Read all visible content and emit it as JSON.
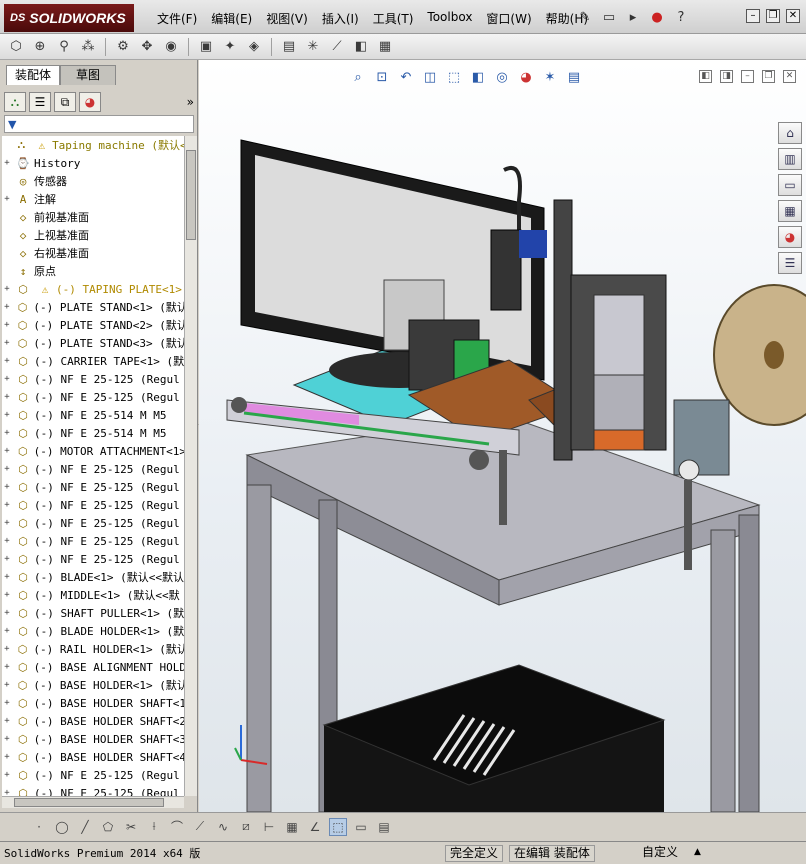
{
  "app": {
    "logo_brand": "DS",
    "logo_text": "SOLIDWORKS"
  },
  "menu": [
    "文件(F)",
    "编辑(E)",
    "视图(V)",
    "插入(I)",
    "工具(T)",
    "Toolbox",
    "窗口(W)",
    "帮助(H)"
  ],
  "title_tools": [
    "pin-icon",
    "new-doc-icon",
    "open-icon",
    "rebuild-traffic-icon",
    "help-icon"
  ],
  "window_controls": [
    "minimize",
    "restore",
    "close"
  ],
  "toolbar": {
    "buttons": [
      "edit-component-icon",
      "insert-components-icon",
      "mate-icon",
      "pattern-icon",
      "smart-fasteners-icon",
      "move-component-icon",
      "show-hidden-icon",
      "assembly-features-icon",
      "reference-geometry-icon",
      "new-motion-study-icon",
      "bill-of-materials-icon",
      "exploded-view-icon",
      "explode-line-sketch-icon",
      "interference-detection-icon",
      "instant3d-icon"
    ]
  },
  "left_panel": {
    "tabs": [
      {
        "label": "装配体",
        "active": true
      },
      {
        "label": "草图",
        "active": false
      }
    ],
    "fm_icons": [
      "featuremanager-icon",
      "propertymanager-icon",
      "configuration-icon",
      "display-manager-icon"
    ],
    "more": "»",
    "filter_glyph": "▼",
    "tree": [
      {
        "label": "Taping machine  (默认<默",
        "icon": "assembly-icon",
        "expand": "",
        "type": "top"
      },
      {
        "label": "History",
        "icon": "history-icon",
        "expand": "+",
        "type": "node"
      },
      {
        "label": "传感器",
        "icon": "sensor-icon",
        "expand": "",
        "type": "node"
      },
      {
        "label": "注解",
        "icon": "annotation-icon",
        "expand": "+",
        "type": "node"
      },
      {
        "label": "前视基准面",
        "icon": "plane-icon",
        "expand": "",
        "type": "node"
      },
      {
        "label": "上视基准面",
        "icon": "plane-icon",
        "expand": "",
        "type": "node"
      },
      {
        "label": "右视基准面",
        "icon": "plane-icon",
        "expand": "",
        "type": "node"
      },
      {
        "label": "原点",
        "icon": "origin-icon",
        "expand": "",
        "type": "node"
      },
      {
        "label": "(-) TAPING PLATE<1>",
        "icon": "part-icon",
        "expand": "+",
        "type": "warn"
      },
      {
        "label": "(-) PLATE STAND<1> (默认",
        "icon": "part-icon",
        "expand": "+",
        "type": "part"
      },
      {
        "label": "(-) PLATE STAND<2> (默认",
        "icon": "part-icon",
        "expand": "+",
        "type": "part"
      },
      {
        "label": "(-) PLATE STAND<3> (默认",
        "icon": "part-icon",
        "expand": "+",
        "type": "part"
      },
      {
        "label": "(-) CARRIER TAPE<1> (默",
        "icon": "part-icon",
        "expand": "+",
        "type": "part"
      },
      {
        "label": "(-) NF E 25-125  (Regul",
        "icon": "part-icon",
        "expand": "+",
        "type": "part"
      },
      {
        "label": "(-) NF E 25-125  (Regul",
        "icon": "part-icon",
        "expand": "+",
        "type": "part"
      },
      {
        "label": "(-) NF E 25-514  M M5",
        "icon": "part-icon",
        "expand": "+",
        "type": "part"
      },
      {
        "label": "(-) NF E 25-514  M M5",
        "icon": "part-icon",
        "expand": "+",
        "type": "part"
      },
      {
        "label": "(-) MOTOR ATTACHMENT<1>",
        "icon": "part-icon",
        "expand": "+",
        "type": "part"
      },
      {
        "label": "(-) NF E 25-125  (Regul",
        "icon": "part-icon",
        "expand": "+",
        "type": "part"
      },
      {
        "label": "(-) NF E 25-125  (Regul",
        "icon": "part-icon",
        "expand": "+",
        "type": "part"
      },
      {
        "label": "(-) NF E 25-125  (Regul",
        "icon": "part-icon",
        "expand": "+",
        "type": "part"
      },
      {
        "label": "(-) NF E 25-125  (Regul",
        "icon": "part-icon",
        "expand": "+",
        "type": "part"
      },
      {
        "label": "(-) NF E 25-125  (Regul",
        "icon": "part-icon",
        "expand": "+",
        "type": "part"
      },
      {
        "label": "(-) NF E 25-125  (Regul",
        "icon": "part-icon",
        "expand": "+",
        "type": "part"
      },
      {
        "label": "(-) BLADE<1> (默认<<默认",
        "icon": "part-icon",
        "expand": "+",
        "type": "part"
      },
      {
        "label": "(-) MIDDLE<1> (默认<<默",
        "icon": "part-icon",
        "expand": "+",
        "type": "part"
      },
      {
        "label": "(-) SHAFT PULLER<1> (默",
        "icon": "part-icon",
        "expand": "+",
        "type": "part"
      },
      {
        "label": "(-) BLADE HOLDER<1> (默",
        "icon": "part-icon",
        "expand": "+",
        "type": "part"
      },
      {
        "label": "(-) RAIL HOLDER<1> (默认",
        "icon": "part-icon",
        "expand": "+",
        "type": "part"
      },
      {
        "label": "(-) BASE ALIGNMENT HOLD",
        "icon": "part-icon",
        "expand": "+",
        "type": "part"
      },
      {
        "label": "(-) BASE HOLDER<1> (默认",
        "icon": "part-icon",
        "expand": "+",
        "type": "part"
      },
      {
        "label": "(-) BASE HOLDER SHAFT<1",
        "icon": "part-icon",
        "expand": "+",
        "type": "part"
      },
      {
        "label": "(-) BASE HOLDER SHAFT<2",
        "icon": "part-icon",
        "expand": "+",
        "type": "part"
      },
      {
        "label": "(-) BASE HOLDER SHAFT<3",
        "icon": "part-icon",
        "expand": "+",
        "type": "part"
      },
      {
        "label": "(-) BASE HOLDER SHAFT<4",
        "icon": "part-icon",
        "expand": "+",
        "type": "part"
      },
      {
        "label": "(-) NF E 25-125  (Regul",
        "icon": "part-icon",
        "expand": "+",
        "type": "part"
      },
      {
        "label": "(-) NF E 25-125  (Regul",
        "icon": "part-icon",
        "expand": "+",
        "type": "part"
      }
    ]
  },
  "view_toolbar": [
    "zoom-to-fit-icon",
    "zoom-to-area-icon",
    "previous-view-icon",
    "section-view-icon",
    "view-orientation-icon",
    "display-style-icon",
    "hide-show-items-icon",
    "edit-appearance-icon",
    "apply-scene-icon",
    "view-settings-icon"
  ],
  "task_pane": [
    "home-icon",
    "design-library-icon",
    "file-explorer-icon",
    "view-palette-icon",
    "appearances-icon",
    "custom-properties-icon"
  ],
  "sketch_toolbar": [
    "point-icon",
    "circle-icon",
    "line-icon",
    "polygon-icon",
    "trim-icon",
    "mirror-icon",
    "arc-icon",
    "construction-icon",
    "spline-icon",
    "offset-icon",
    "dimension-icon",
    "grid-icon",
    "angle-icon",
    "3d-view-icon",
    "plan-view-icon",
    "table-icon"
  ],
  "status": {
    "product": "SolidWorks Premium 2014 x64 版",
    "definition": "完全定义",
    "mode": "在编辑 装配体",
    "units": "自定义",
    "caret": "▲"
  },
  "colors": {
    "frame": "#9a9aa2",
    "frame_dark": "#6d6d76",
    "teal": "#4fd1d6",
    "pink": "#e08be0",
    "brown": "#a05a28",
    "green": "#2aa64a",
    "tape_roll": "#c9b38a",
    "monitor": "#1a1a1a"
  }
}
